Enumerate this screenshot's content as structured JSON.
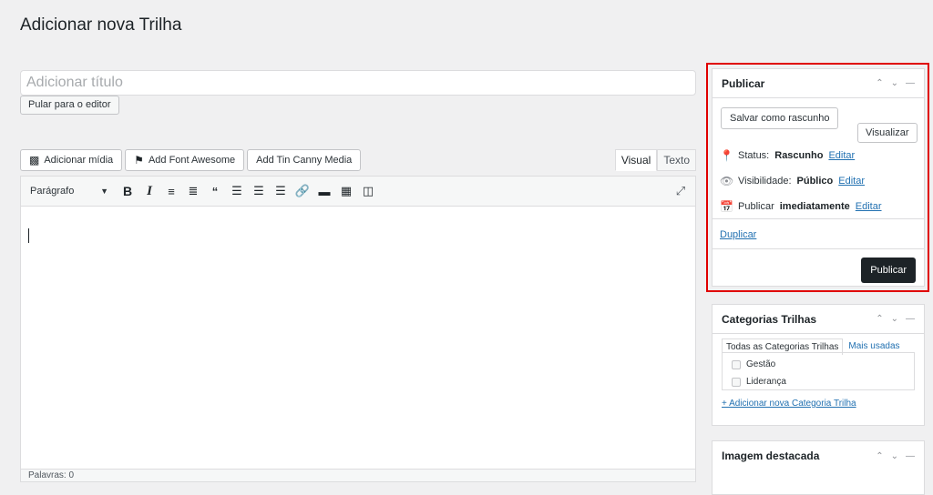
{
  "page": {
    "title": "Adicionar nova Trilha"
  },
  "title_field": {
    "placeholder": "Adicionar título"
  },
  "skip_button": "Pular para o editor",
  "media_buttons": {
    "add_media": "Adicionar mídia",
    "font_awesome": "Add Font Awesome",
    "tin_canny": "Add Tin Canny Media"
  },
  "editor_tabs": {
    "visual": "Visual",
    "text": "Texto"
  },
  "toolbar": {
    "format": "Parágrafo",
    "bold": "B",
    "italic": "I"
  },
  "word_count": "Palavras: 0",
  "publish_box": {
    "title": "Publicar",
    "save_draft": "Salvar como rascunho",
    "preview": "Visualizar",
    "status_label": "Status:",
    "status_value": "Rascunho",
    "visibility_label": "Visibilidade:",
    "visibility_value": "Público",
    "schedule_label": "Publicar",
    "schedule_value": "imediatamente",
    "edit": "Editar",
    "duplicate": "Duplicar",
    "publish": "Publicar"
  },
  "categories_box": {
    "title": "Categorias Trilhas",
    "tab_all": "Todas as Categorias Trilhas",
    "tab_most_used": "Mais usadas",
    "items": [
      "Gestão",
      "Liderança"
    ],
    "add_new": "+ Adicionar nova Categoria Trilha"
  },
  "featured_box": {
    "title": "Imagem destacada"
  },
  "colors": {
    "highlight": "#e00000",
    "link": "#2271b1",
    "primary_button": "#1d2327"
  },
  "icons": [
    "media-icon",
    "flag-icon",
    "bold-icon",
    "italic-icon",
    "bullet-list-icon",
    "numbered-list-icon",
    "quote-icon",
    "align-left-icon",
    "align-center-icon",
    "align-right-icon",
    "link-icon",
    "read-more-icon",
    "toolbar-toggle-icon",
    "monitor-icon",
    "expand-icon",
    "pin-icon",
    "eye-icon",
    "calendar-icon",
    "chevron-up-icon",
    "chevron-down-icon",
    "collapse-icon"
  ]
}
